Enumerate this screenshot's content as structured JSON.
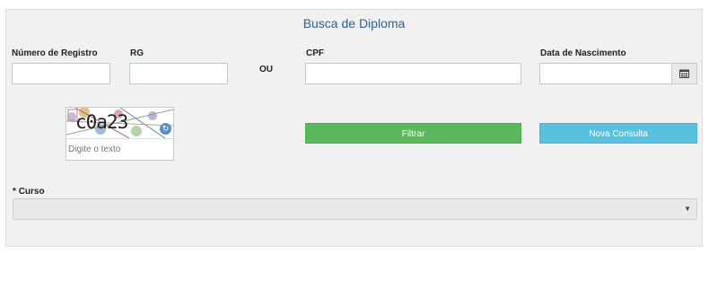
{
  "header": {
    "title": "Busca de Diploma"
  },
  "fields": {
    "registro": {
      "label": "Número de Registro",
      "value": ""
    },
    "rg": {
      "label": "RG",
      "value": ""
    },
    "ou": "OU",
    "cpf": {
      "label": "CPF",
      "value": ""
    },
    "nascimento": {
      "label": "Data de Nascimento",
      "value": ""
    }
  },
  "captcha": {
    "text": "c0a23",
    "placeholder": "Digite o texto"
  },
  "buttons": {
    "filtrar": "Filtrar",
    "nova_consulta": "Nova Consulta"
  },
  "curso": {
    "required_mark": "*",
    "label": "Curso",
    "selected": ""
  },
  "icons": {
    "calendar": "calendar-icon",
    "refresh": "refresh-icon",
    "select_arrow": "chevron-down-icon"
  },
  "colors": {
    "title": "#2d6187",
    "filtrar": "#5cb85c",
    "nova_consulta": "#5bc0de",
    "panel": "#f1f1f1"
  }
}
